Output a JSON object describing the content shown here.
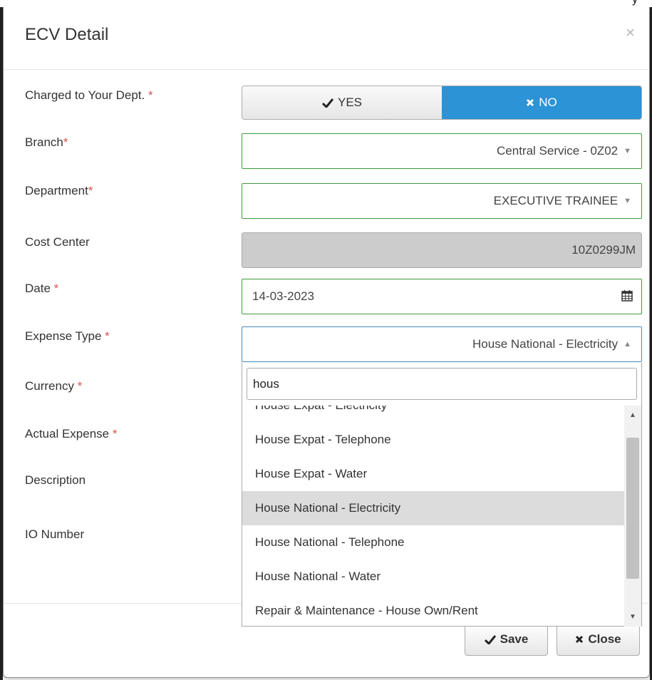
{
  "backdrop": {
    "clipped_text": "y"
  },
  "dialog": {
    "title": "ECV Detail",
    "close_glyph": "×"
  },
  "form": {
    "charged": {
      "label": "Charged to Your Dept. ",
      "required": "*",
      "yes_label": "YES",
      "no_label": "NO",
      "selected": "NO"
    },
    "branch": {
      "label": "Branch",
      "required": "*",
      "value": "Central Service - 0Z02"
    },
    "department": {
      "label": "Department",
      "required": "*",
      "value": "EXECUTIVE TRAINEE"
    },
    "cost_center": {
      "label": "Cost Center",
      "value": "10Z0299JM"
    },
    "date": {
      "label": "Date ",
      "required": "*",
      "value": "14-03-2023",
      "icon": "calendar-icon"
    },
    "expense_type": {
      "label": "Expense Type ",
      "required": "*",
      "value": "House National - Electricity"
    },
    "currency": {
      "label": "Currency ",
      "required": "*"
    },
    "actual_expense": {
      "label": "Actual Expense ",
      "required": "*"
    },
    "description": {
      "label": "Description"
    },
    "io_number": {
      "label": "IO Number"
    }
  },
  "dropdown": {
    "search_value": "hous",
    "options": [
      "House Expat - Electricity",
      "House Expat - Telephone",
      "House Expat - Water",
      "House National - Electricity",
      "House National - Telephone",
      "House National - Water",
      "Repair & Maintenance - House Own/Rent"
    ],
    "highlighted": "House National - Electricity"
  },
  "footer": {
    "save_label": "Save",
    "close_label": "Close"
  },
  "colors": {
    "primary": "#2b93d6",
    "valid_border": "#3c9a3c",
    "required": "#d9534f"
  }
}
